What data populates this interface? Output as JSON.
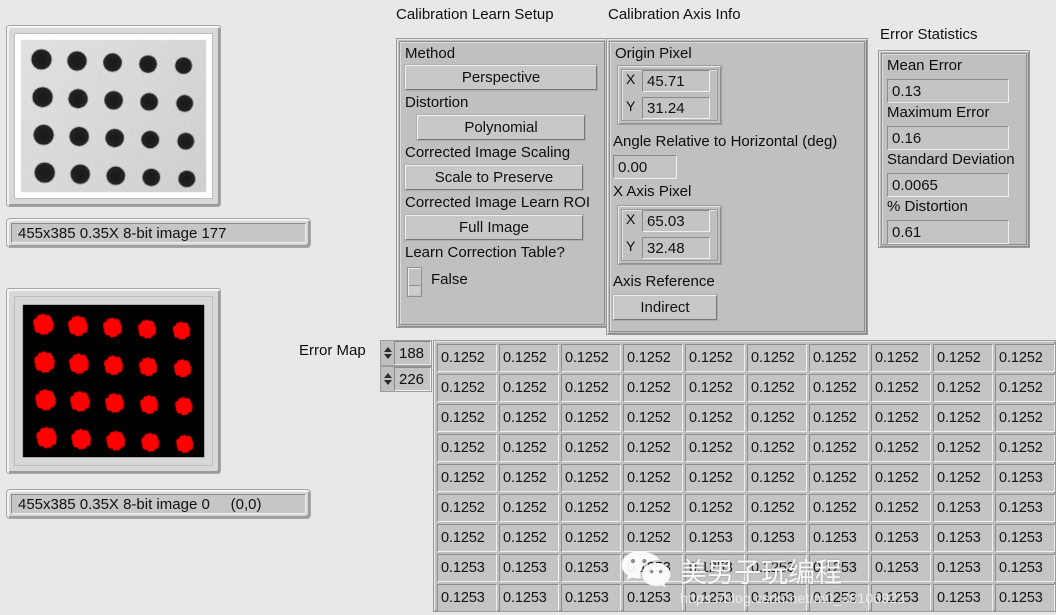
{
  "groups": {
    "learn_setup": "Calibration Learn Setup",
    "axis_info": "Calibration Axis Info",
    "error_stats": "Error Statistics"
  },
  "learn_setup": {
    "method_label": "Method",
    "method_value": "Perspective",
    "distortion_label": "Distortion",
    "distortion_value": "Polynomial",
    "scaling_label": "Corrected Image Scaling",
    "scaling_value": "Scale to Preserve",
    "roi_label": "Corrected Image Learn ROI",
    "roi_value": "Full Image",
    "learn_table_label": "Learn Correction Table?",
    "learn_table_value": "False"
  },
  "axis_info": {
    "origin_label": "Origin Pixel",
    "origin_x_label": "X",
    "origin_x_value": "45.71",
    "origin_y_label": "Y",
    "origin_y_value": "31.24",
    "angle_label": "Angle Relative to Horizontal (deg)",
    "angle_value": "0.00",
    "xaxis_label": "X Axis Pixel",
    "xaxis_x_label": "X",
    "xaxis_x_value": "65.03",
    "xaxis_y_label": "Y",
    "xaxis_y_value": "32.48",
    "axis_ref_label": "Axis Reference",
    "axis_ref_value": "Indirect"
  },
  "error_stats": {
    "mean_label": "Mean Error",
    "mean_value": "0.13",
    "max_label": "Maximum Error",
    "max_value": "0.16",
    "std_label": "Standard Deviation",
    "std_value": "0.0065",
    "pct_label": "% Distortion",
    "pct_value": "0.61"
  },
  "images": {
    "top_caption": "455x385 0.35X 8-bit image 177",
    "bottom_caption": "455x385 0.35X 8-bit image 0     (0,0)",
    "grid_cols": 5,
    "grid_rows": 4,
    "binary_dot_color": "#ff0000",
    "binary_bg_color": "#000000"
  },
  "error_map": {
    "label": "Error Map",
    "index_row": "188",
    "index_col": "226"
  },
  "watermark": {
    "text": "美男子玩编程",
    "url": "https://blog.csdn.net/m0_38106923",
    "logo": "wechat-icon"
  },
  "chart_data": {
    "type": "table",
    "title": "Error Map",
    "rows": 9,
    "cols": 10,
    "values": [
      [
        "0.1252",
        "0.1252",
        "0.1252",
        "0.1252",
        "0.1252",
        "0.1252",
        "0.1252",
        "0.1252",
        "0.1252",
        "0.1252"
      ],
      [
        "0.1252",
        "0.1252",
        "0.1252",
        "0.1252",
        "0.1252",
        "0.1252",
        "0.1252",
        "0.1252",
        "0.1252",
        "0.1252"
      ],
      [
        "0.1252",
        "0.1252",
        "0.1252",
        "0.1252",
        "0.1252",
        "0.1252",
        "0.1252",
        "0.1252",
        "0.1252",
        "0.1252"
      ],
      [
        "0.1252",
        "0.1252",
        "0.1252",
        "0.1252",
        "0.1252",
        "0.1252",
        "0.1252",
        "0.1252",
        "0.1252",
        "0.1252"
      ],
      [
        "0.1252",
        "0.1252",
        "0.1252",
        "0.1252",
        "0.1252",
        "0.1252",
        "0.1252",
        "0.1252",
        "0.1252",
        "0.1253"
      ],
      [
        "0.1252",
        "0.1252",
        "0.1252",
        "0.1252",
        "0.1252",
        "0.1252",
        "0.1252",
        "0.1252",
        "0.1253",
        "0.1253"
      ],
      [
        "0.1252",
        "0.1252",
        "0.1252",
        "0.1252",
        "0.1253",
        "0.1253",
        "0.1253",
        "0.1253",
        "0.1253",
        "0.1253"
      ],
      [
        "0.1253",
        "0.1253",
        "0.1253",
        "0.1253",
        "0.1253",
        "0.1253",
        "0.1253",
        "0.1253",
        "0.1253",
        "0.1253"
      ],
      [
        "0.1253",
        "0.1253",
        "0.1253",
        "0.1253",
        "0.1253",
        "0.1253",
        "0.1253",
        "0.1253",
        "0.1253",
        "0.1253"
      ]
    ]
  }
}
